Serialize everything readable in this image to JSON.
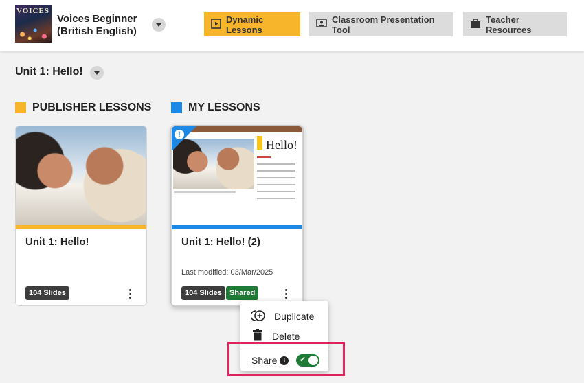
{
  "header": {
    "cover_text": "VOICES",
    "course_title_line1": "Voices Beginner",
    "course_title_line2": "(British English)",
    "nav": [
      {
        "label": "Dynamic Lessons",
        "icon": "play-square-icon",
        "active": true
      },
      {
        "label": "Classroom Presentation Tool",
        "icon": "presenter-icon",
        "active": false
      },
      {
        "label": "Teacher Resources",
        "icon": "briefcase-icon",
        "active": false
      }
    ]
  },
  "unit": {
    "title": "Unit 1: Hello!"
  },
  "sections": {
    "publisher": {
      "label": "PUBLISHER LESSONS",
      "color": "#F7B52C"
    },
    "mine": {
      "label": "MY LESSONS",
      "color": "#1E88E5"
    }
  },
  "cards": [
    {
      "title": "Unit 1: Hello!",
      "slides": "104 Slides",
      "bar_color": "#F7B52C"
    },
    {
      "title": "Unit 1: Hello! (2)",
      "modified": "Last modified: 03/Mar/2025",
      "slides": "104 Slides",
      "shared": "Shared",
      "bar_color": "#1E88E5",
      "slide_heading": "Hello!"
    }
  ],
  "menu": {
    "duplicate": "Duplicate",
    "delete": "Delete",
    "share": "Share",
    "share_enabled": true
  },
  "colors": {
    "accent": "#F7B52C",
    "blue": "#1E88E5",
    "green": "#1E7A34",
    "highlight": "#E0245E"
  }
}
